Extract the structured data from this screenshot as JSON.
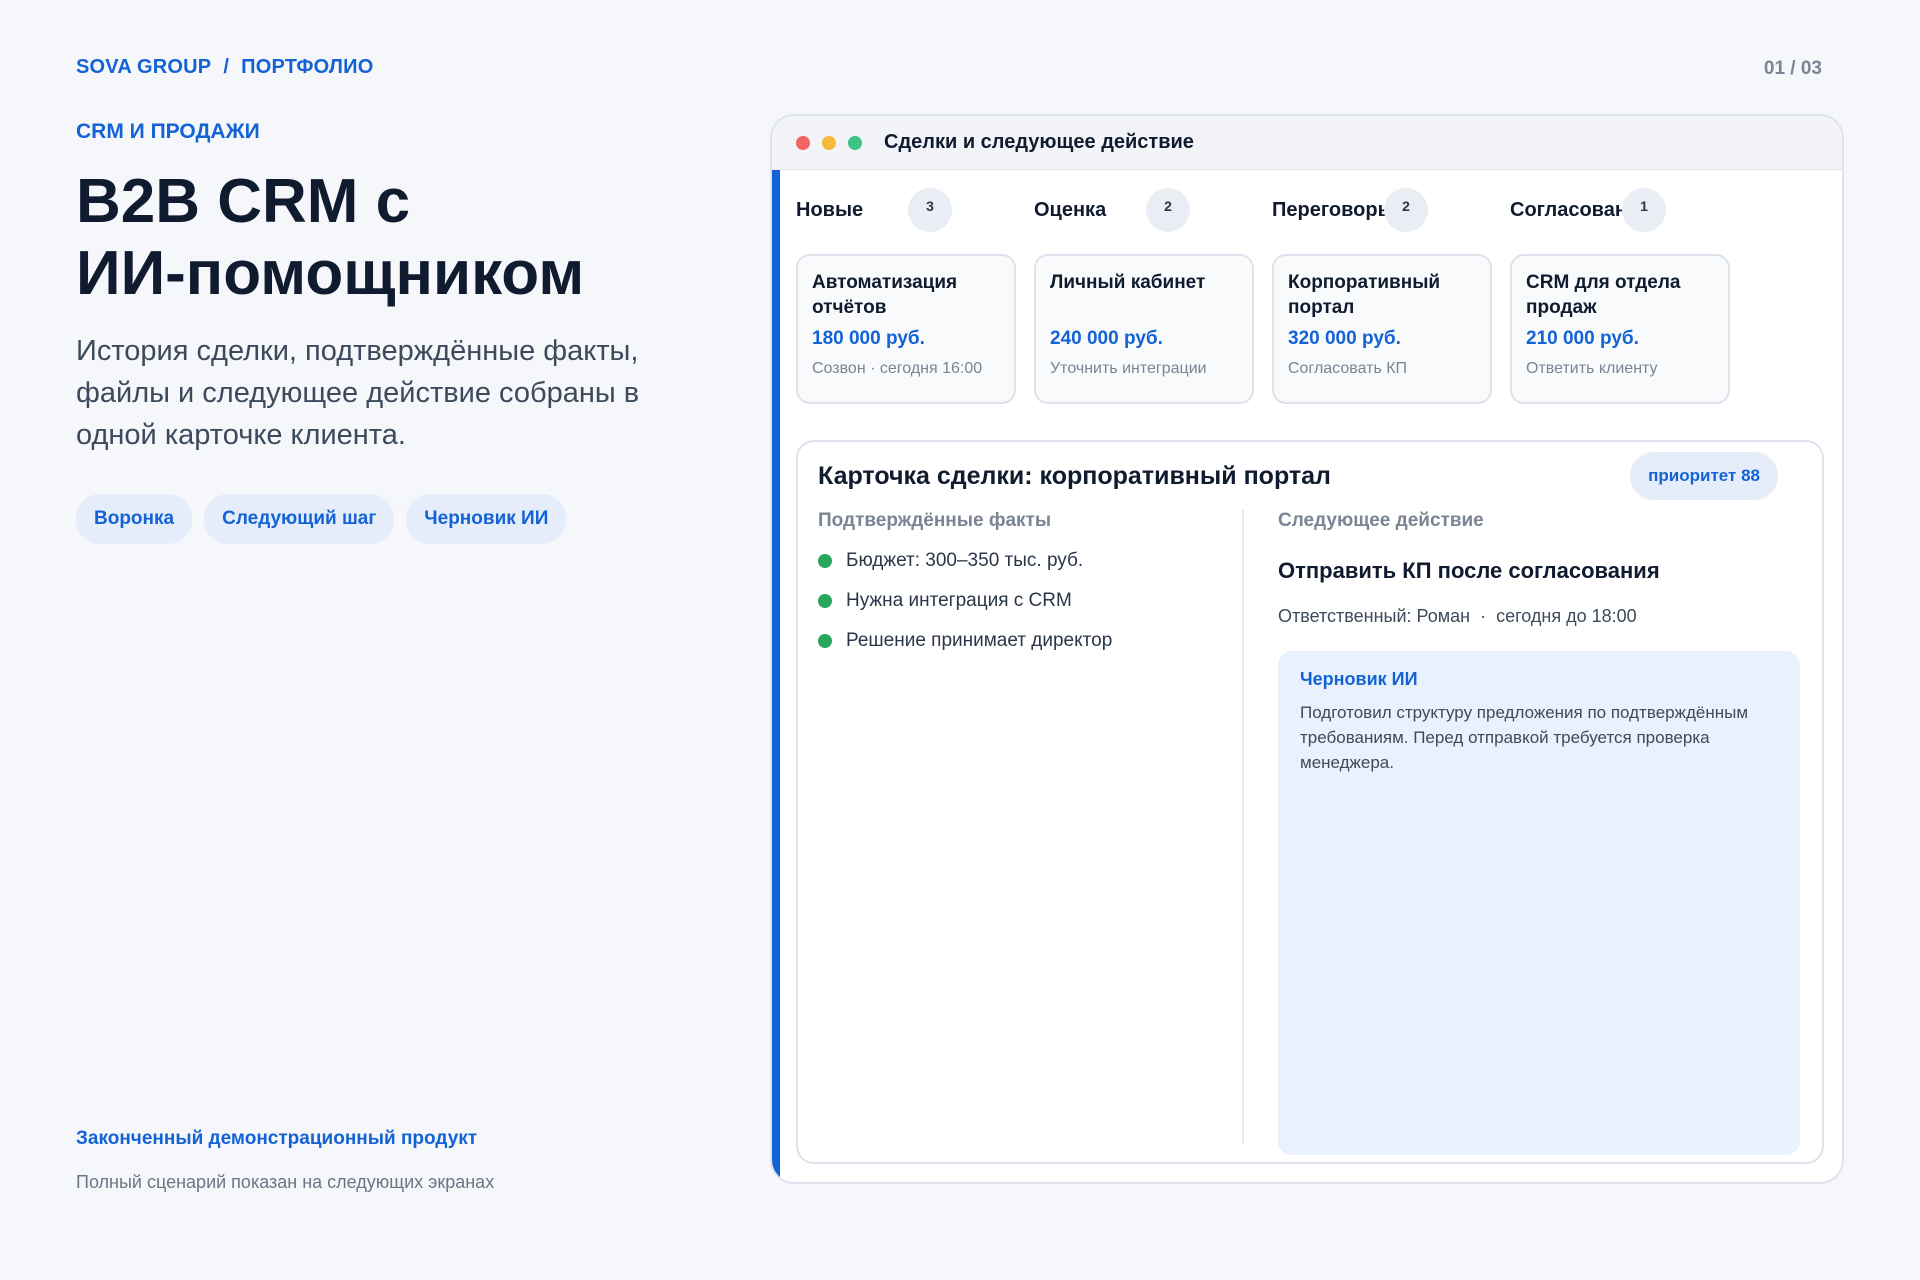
{
  "breadcrumb": {
    "brand": "SOVA GROUP",
    "separator": "/",
    "section": "ПОРТФОЛИО"
  },
  "page_counter": "01 / 03",
  "hero": {
    "eyebrow": "CRM И ПРОДАЖИ",
    "title_line1": "B2B CRM с",
    "title_line2": "ИИ-помощником",
    "subtitle": "История сделки, подтверждённые факты, файлы и следующее действие собраны в одной карточке клиента.",
    "chips": [
      "Воронка",
      "Следующий шаг",
      "Черновик ИИ"
    ]
  },
  "footer": {
    "title": "Законченный демонстрационный продукт",
    "subtitle": "Полный сценарий показан на следующих экранах"
  },
  "window": {
    "title": "Сделки и следующее действие",
    "columns": [
      {
        "name": "Новые",
        "count": "3"
      },
      {
        "name": "Оценка",
        "count": "2"
      },
      {
        "name": "Переговоры",
        "count": "2"
      },
      {
        "name": "Согласование",
        "count": "1"
      }
    ],
    "deals": [
      {
        "name": "Автоматизация отчётов",
        "amount": "180 000 руб.",
        "note": "Созвон · сегодня 16:00"
      },
      {
        "name": "Личный кабинет",
        "amount": "240 000 руб.",
        "note": "Уточнить интеграции"
      },
      {
        "name": "Корпоративный портал",
        "amount": "320 000 руб.",
        "note": "Согласовать КП"
      },
      {
        "name": "CRM для отдела продаж",
        "amount": "210 000 руб.",
        "note": "Ответить клиенту"
      }
    ],
    "detail": {
      "title": "Карточка сделки: корпоративный портал",
      "priority": "приоритет 88",
      "facts_label": "Подтверждённые факты",
      "facts": [
        "Бюджет: 300–350 тыс. руб.",
        "Нужна интеграция с CRM",
        "Решение принимает директор"
      ],
      "action_label": "Следующее действие",
      "action_title": "Отправить КП после согласования",
      "owner": "Ответственный: Роман",
      "meta_sep": "·",
      "due": "сегодня до 18:00",
      "ai": {
        "title": "Черновик ИИ",
        "text": "Подготовил структуру предложения по подтверждённым требованиям. Перед отправкой требуется проверка менеджера."
      }
    }
  },
  "colors": {
    "accent": "#1463d6",
    "fact_dot": "#2aa660",
    "background": "#f5f7fb"
  }
}
